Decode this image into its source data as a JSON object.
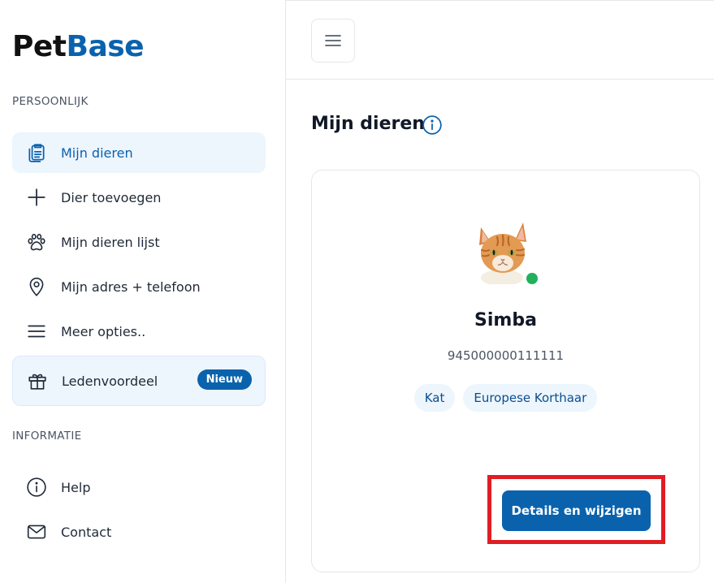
{
  "logo": {
    "pet": "Pet",
    "base": "Base"
  },
  "sidebar": {
    "section_personal": "PERSOONLIJK",
    "section_info": "INFORMATIE",
    "items": [
      {
        "label": "Mijn dieren",
        "icon": "clipboard-icon",
        "active": true
      },
      {
        "label": "Dier toevoegen",
        "icon": "plus-icon"
      },
      {
        "label": "Mijn dieren lijst",
        "icon": "paw-icon"
      },
      {
        "label": "Mijn adres + telefoon",
        "icon": "location-pin-icon"
      },
      {
        "label": "Meer opties..",
        "icon": "menu-lines-icon"
      }
    ],
    "promo": {
      "label": "Ledenvoordeel",
      "badge": "Nieuw",
      "icon": "gift-icon"
    },
    "info_items": [
      {
        "label": "Help",
        "icon": "info-circle-icon"
      },
      {
        "label": "Contact",
        "icon": "mail-icon"
      }
    ]
  },
  "main": {
    "title": "Mijn dieren",
    "pet": {
      "name": "Simba",
      "chip": "945000000111111",
      "tags": [
        "Kat",
        "Europese Korthaar"
      ],
      "status": "online"
    },
    "details_button": "Details en wijzigen"
  },
  "colors": {
    "brand": "#0a62ad",
    "active_bg": "#edf5fd",
    "status_green": "#21b05b",
    "highlight_red": "#e11d24"
  }
}
